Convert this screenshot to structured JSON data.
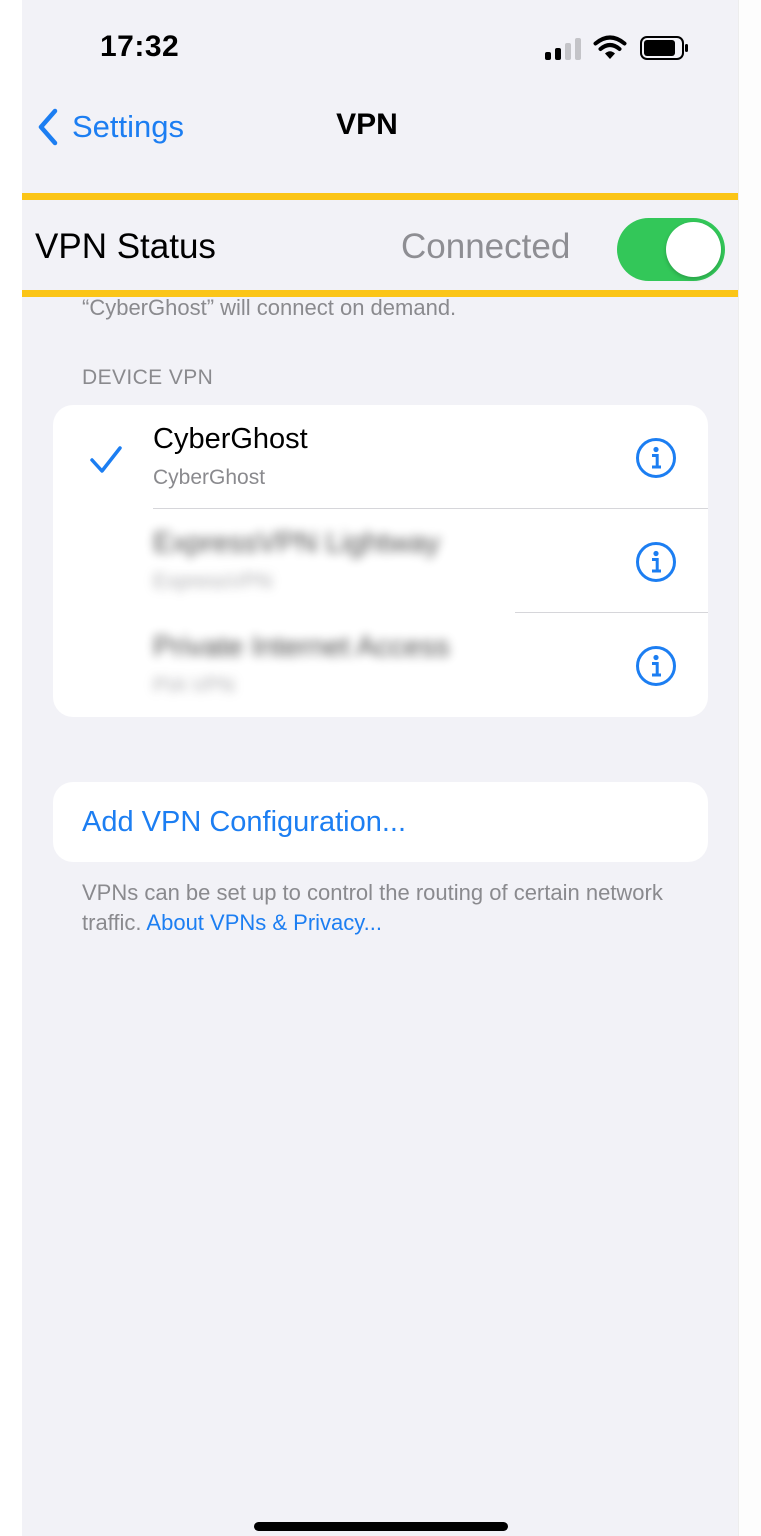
{
  "status_bar": {
    "time": "17:32",
    "signal_icon": "cellular-signal-icon",
    "wifi_icon": "wifi-icon",
    "battery_icon": "battery-icon"
  },
  "nav": {
    "back_label": "Settings",
    "title": "VPN"
  },
  "vpn_status": {
    "label": "VPN Status",
    "value": "Connected",
    "toggle_on": true,
    "toggle_color": "#33c759",
    "highlight_color": "#fbc517"
  },
  "demand_note": "“CyberGhost” will connect on demand.",
  "device_vpn": {
    "header": "DEVICE VPN",
    "items": [
      {
        "name": "CyberGhost",
        "type": "CyberGhost",
        "selected": true,
        "blurred": false
      },
      {
        "name": "ExpressVPN Lightway",
        "type": "ExpressVPN",
        "selected": false,
        "blurred": true
      },
      {
        "name": "Private Internet Access",
        "type": "PIA VPN",
        "selected": false,
        "blurred": true
      }
    ]
  },
  "add_config": {
    "label": "Add VPN Configuration..."
  },
  "footer": {
    "text": "VPNs can be set up to control the routing of certain network traffic.",
    "link": "About VPNs & Privacy..."
  },
  "accent_color": "#1c7ef2"
}
